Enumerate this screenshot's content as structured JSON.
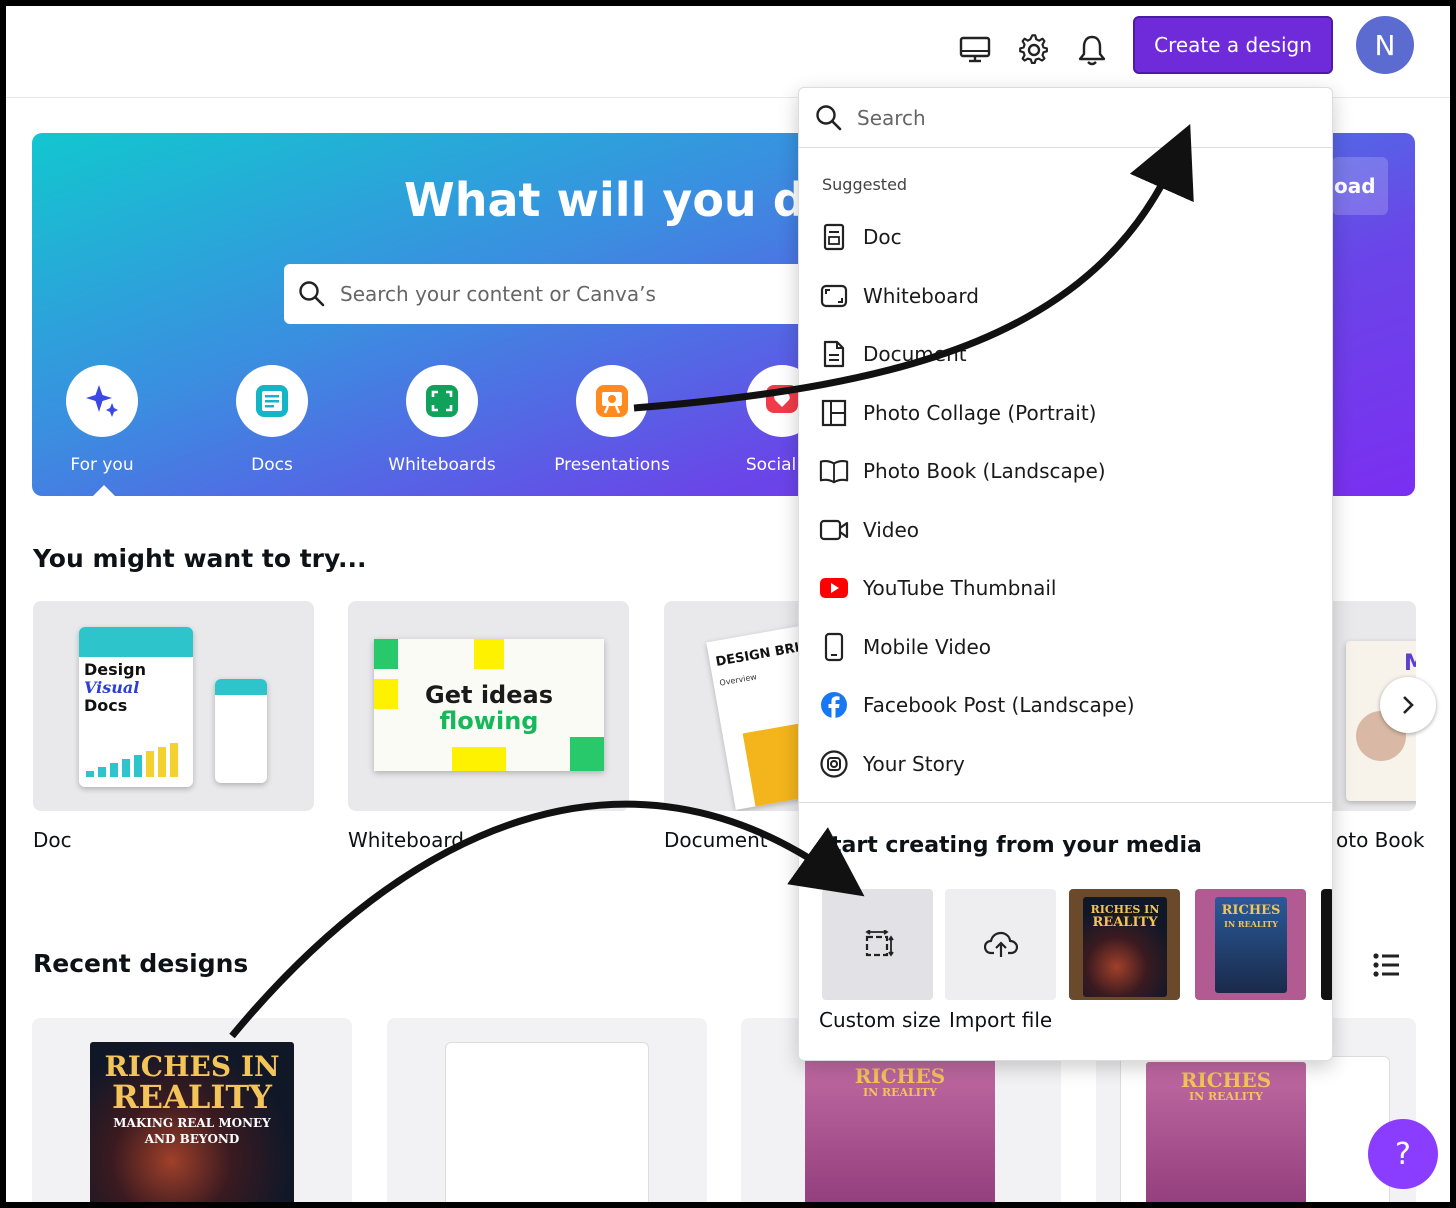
{
  "topbar": {
    "create_label": "Create a design",
    "avatar_letter": "N"
  },
  "hero": {
    "title": "What will you des",
    "search_placeholder": "Search your content or Canva’s",
    "upload_label": "oad",
    "categories": [
      {
        "label": "For you"
      },
      {
        "label": "Docs"
      },
      {
        "label": "Whiteboards"
      },
      {
        "label": "Presentations"
      },
      {
        "label": "Social m"
      }
    ]
  },
  "try_section": {
    "title": "You might want to try...",
    "cards": [
      {
        "label": "Doc"
      },
      {
        "label": "Whiteboard"
      },
      {
        "label": "Document"
      },
      {
        "label": "oto Book"
      }
    ],
    "doc_thumb": {
      "line1": "Design",
      "line2": "Visual",
      "line3": "Docs"
    },
    "wb_thumb": {
      "line1": "Get ideas",
      "line2": "flowing"
    },
    "brief_thumb": {
      "title": "DESIGN BRIE",
      "overview": "Overview"
    },
    "book_thumb": {
      "letter": "M"
    }
  },
  "recent_section": {
    "title": "Recent designs",
    "book1": {
      "line1": "RICHES IN",
      "line2": "REALITY",
      "line3": "MAKING REAL MONEY",
      "line4": "AND BEYOND"
    },
    "book2": {
      "line1": "RICHES",
      "line2": "IN REALITY"
    }
  },
  "dropdown": {
    "search_placeholder": "Search",
    "suggested_label": "Suggested",
    "items": [
      {
        "label": "Doc",
        "icon": "doc-icon"
      },
      {
        "label": "Whiteboard",
        "icon": "whiteboard-icon"
      },
      {
        "label": "Document",
        "icon": "document-icon"
      },
      {
        "label": "Photo Collage (Portrait)",
        "icon": "collage-icon"
      },
      {
        "label": "Photo Book (Landscape)",
        "icon": "book-icon"
      },
      {
        "label": "Video",
        "icon": "video-icon"
      },
      {
        "label": "YouTube Thumbnail",
        "icon": "youtube-icon"
      },
      {
        "label": "Mobile Video",
        "icon": "mobile-icon"
      },
      {
        "label": "Facebook Post (Landscape)",
        "icon": "facebook-icon"
      },
      {
        "label": "Your Story",
        "icon": "instagram-icon"
      }
    ],
    "media_title": "tart creating from your media",
    "custom_size_label": "Custom size",
    "import_label": "Import file",
    "media_book": {
      "line1": "RICHES IN",
      "line2": "REALITY",
      "line3": "RICHES",
      "line4": "IN REALITY"
    }
  },
  "help_label": "?",
  "colors": {
    "accent": "#6f2bd9",
    "help": "#8b3dff",
    "avatar": "#5b6bd0"
  }
}
